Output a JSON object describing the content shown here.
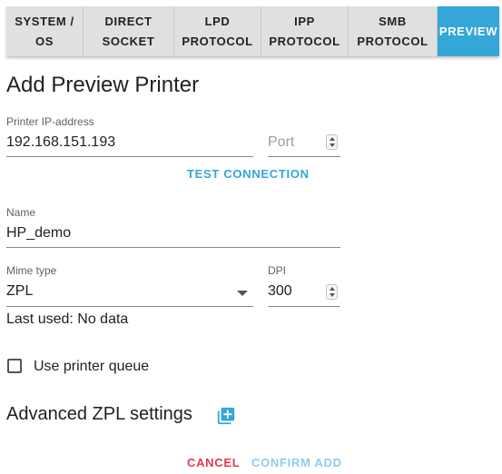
{
  "tabs": [
    {
      "label": "SYSTEM /\nOS"
    },
    {
      "label": "DIRECT\nSOCKET"
    },
    {
      "label": "LPD\nPROTOCOL"
    },
    {
      "label": "IPP\nPROTOCOL"
    },
    {
      "label": "SMB\nPROTOCOL"
    },
    {
      "label": "PREVIEW",
      "active": true
    }
  ],
  "form": {
    "title": "Add Preview Printer",
    "ip_label": "Printer IP-address",
    "ip_value": "192.168.151.193",
    "port_placeholder": "Port",
    "test_connection": "TEST CONNECTION",
    "name_label": "Name",
    "name_value": "HP_demo",
    "mime_label": "Mime type",
    "mime_value": "ZPL",
    "dpi_label": "DPI",
    "dpi_value": "300",
    "last_used": "Last used: No data",
    "use_queue_label": "Use printer queue",
    "advanced_title": "Advanced ZPL settings",
    "cancel": "CANCEL",
    "confirm": "CONFIRM ADD"
  },
  "colors": {
    "accent": "#35a6d8",
    "cancel": "#e53950",
    "confirm_disabled": "#8fcde8"
  },
  "icons": {
    "advanced_add": "library-add-icon"
  }
}
